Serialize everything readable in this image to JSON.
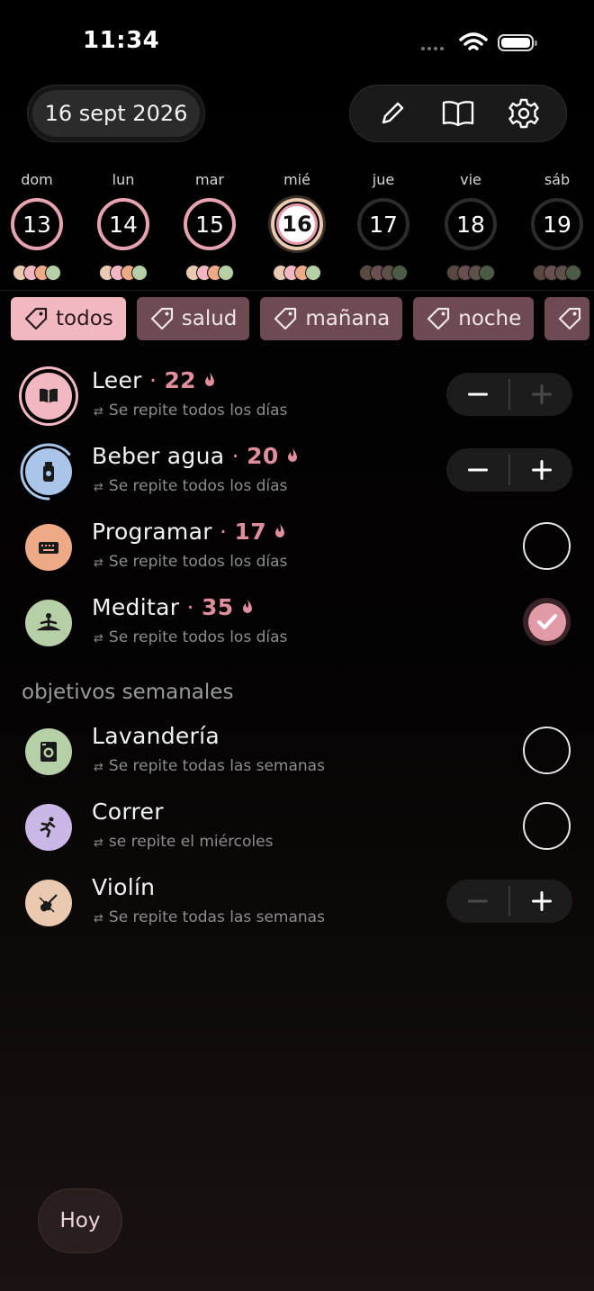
{
  "status_bar": {
    "time": "11:34"
  },
  "header": {
    "date_label": "16 sept 2026",
    "edit_icon": "pencil-icon",
    "journal_icon": "book-icon",
    "settings_icon": "gear-icon"
  },
  "week": [
    {
      "name": "dom",
      "num": "13",
      "state": "completed"
    },
    {
      "name": "lun",
      "num": "14",
      "state": "completed"
    },
    {
      "name": "mar",
      "num": "15",
      "state": "completed"
    },
    {
      "name": "mié",
      "num": "16",
      "state": "today"
    },
    {
      "name": "jue",
      "num": "17",
      "state": "future"
    },
    {
      "name": "vie",
      "num": "18",
      "state": "future"
    },
    {
      "name": "sáb",
      "num": "19",
      "state": "future"
    }
  ],
  "tags": [
    "todos",
    "salud",
    "mañana",
    "noche",
    ""
  ],
  "daily": [
    {
      "name": "Leer",
      "streak": "22",
      "repeat": "Se repite todos los días",
      "control": "stepper",
      "icon": "book-icon",
      "color": "#f2b8c2"
    },
    {
      "name": "Beber agua",
      "streak": "20",
      "repeat": "Se repite todos los días",
      "control": "stepper",
      "icon": "water-bottle-icon",
      "color": "#a9c6ea"
    },
    {
      "name": "Programar",
      "streak": "17",
      "repeat": "Se repite todos los días",
      "control": "checkbox",
      "icon": "keyboard-icon",
      "color": "#eea987"
    },
    {
      "name": "Meditar",
      "streak": "35",
      "repeat": "Se repite todos los días",
      "control": "checked",
      "icon": "meditation-icon",
      "color": "#b6cfa7"
    }
  ],
  "weekly_section": "objetivos semanales",
  "weekly": [
    {
      "name": "Lavandería",
      "repeat": "Se repite todas las semanas",
      "control": "checkbox",
      "icon": "washing-machine-icon",
      "color": "#b6cfa7"
    },
    {
      "name": "Correr",
      "repeat": "se repite el miércoles",
      "control": "checkbox",
      "icon": "running-icon",
      "color": "#c9b8e6"
    },
    {
      "name": "Violín",
      "repeat": "Se repite todas las semanas",
      "control": "stepper",
      "icon": "violin-icon",
      "color": "#e9c9b0"
    }
  ],
  "today_button": "Hoy",
  "colors": {
    "accent": "#f2b8c2",
    "streak": "#e08e9d",
    "tag_inactive": "#6e4a52"
  }
}
